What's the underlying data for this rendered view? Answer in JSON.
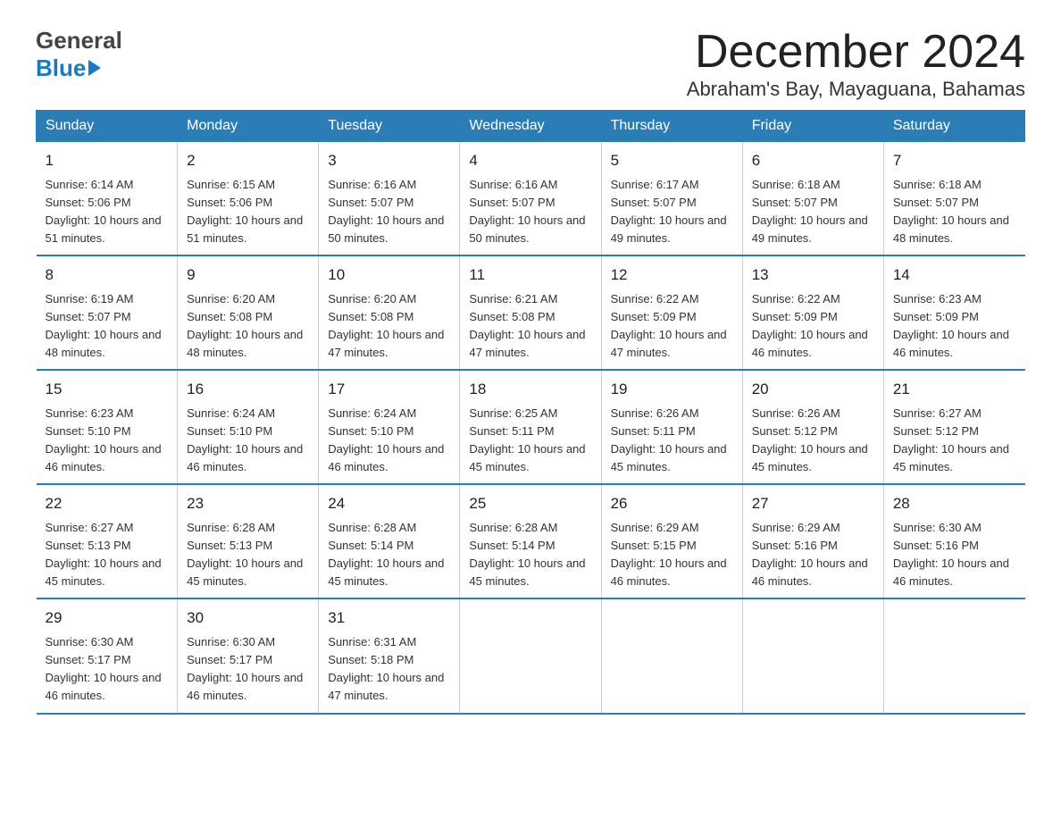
{
  "logo": {
    "top": "General",
    "bottom": "Blue"
  },
  "title": "December 2024",
  "subtitle": "Abraham's Bay, Mayaguana, Bahamas",
  "days_of_week": [
    "Sunday",
    "Monday",
    "Tuesday",
    "Wednesday",
    "Thursday",
    "Friday",
    "Saturday"
  ],
  "weeks": [
    [
      {
        "num": "1",
        "sunrise": "6:14 AM",
        "sunset": "5:06 PM",
        "daylight": "10 hours and 51 minutes."
      },
      {
        "num": "2",
        "sunrise": "6:15 AM",
        "sunset": "5:06 PM",
        "daylight": "10 hours and 51 minutes."
      },
      {
        "num": "3",
        "sunrise": "6:16 AM",
        "sunset": "5:07 PM",
        "daylight": "10 hours and 50 minutes."
      },
      {
        "num": "4",
        "sunrise": "6:16 AM",
        "sunset": "5:07 PM",
        "daylight": "10 hours and 50 minutes."
      },
      {
        "num": "5",
        "sunrise": "6:17 AM",
        "sunset": "5:07 PM",
        "daylight": "10 hours and 49 minutes."
      },
      {
        "num": "6",
        "sunrise": "6:18 AM",
        "sunset": "5:07 PM",
        "daylight": "10 hours and 49 minutes."
      },
      {
        "num": "7",
        "sunrise": "6:18 AM",
        "sunset": "5:07 PM",
        "daylight": "10 hours and 48 minutes."
      }
    ],
    [
      {
        "num": "8",
        "sunrise": "6:19 AM",
        "sunset": "5:07 PM",
        "daylight": "10 hours and 48 minutes."
      },
      {
        "num": "9",
        "sunrise": "6:20 AM",
        "sunset": "5:08 PM",
        "daylight": "10 hours and 48 minutes."
      },
      {
        "num": "10",
        "sunrise": "6:20 AM",
        "sunset": "5:08 PM",
        "daylight": "10 hours and 47 minutes."
      },
      {
        "num": "11",
        "sunrise": "6:21 AM",
        "sunset": "5:08 PM",
        "daylight": "10 hours and 47 minutes."
      },
      {
        "num": "12",
        "sunrise": "6:22 AM",
        "sunset": "5:09 PM",
        "daylight": "10 hours and 47 minutes."
      },
      {
        "num": "13",
        "sunrise": "6:22 AM",
        "sunset": "5:09 PM",
        "daylight": "10 hours and 46 minutes."
      },
      {
        "num": "14",
        "sunrise": "6:23 AM",
        "sunset": "5:09 PM",
        "daylight": "10 hours and 46 minutes."
      }
    ],
    [
      {
        "num": "15",
        "sunrise": "6:23 AM",
        "sunset": "5:10 PM",
        "daylight": "10 hours and 46 minutes."
      },
      {
        "num": "16",
        "sunrise": "6:24 AM",
        "sunset": "5:10 PM",
        "daylight": "10 hours and 46 minutes."
      },
      {
        "num": "17",
        "sunrise": "6:24 AM",
        "sunset": "5:10 PM",
        "daylight": "10 hours and 46 minutes."
      },
      {
        "num": "18",
        "sunrise": "6:25 AM",
        "sunset": "5:11 PM",
        "daylight": "10 hours and 45 minutes."
      },
      {
        "num": "19",
        "sunrise": "6:26 AM",
        "sunset": "5:11 PM",
        "daylight": "10 hours and 45 minutes."
      },
      {
        "num": "20",
        "sunrise": "6:26 AM",
        "sunset": "5:12 PM",
        "daylight": "10 hours and 45 minutes."
      },
      {
        "num": "21",
        "sunrise": "6:27 AM",
        "sunset": "5:12 PM",
        "daylight": "10 hours and 45 minutes."
      }
    ],
    [
      {
        "num": "22",
        "sunrise": "6:27 AM",
        "sunset": "5:13 PM",
        "daylight": "10 hours and 45 minutes."
      },
      {
        "num": "23",
        "sunrise": "6:28 AM",
        "sunset": "5:13 PM",
        "daylight": "10 hours and 45 minutes."
      },
      {
        "num": "24",
        "sunrise": "6:28 AM",
        "sunset": "5:14 PM",
        "daylight": "10 hours and 45 minutes."
      },
      {
        "num": "25",
        "sunrise": "6:28 AM",
        "sunset": "5:14 PM",
        "daylight": "10 hours and 45 minutes."
      },
      {
        "num": "26",
        "sunrise": "6:29 AM",
        "sunset": "5:15 PM",
        "daylight": "10 hours and 46 minutes."
      },
      {
        "num": "27",
        "sunrise": "6:29 AM",
        "sunset": "5:16 PM",
        "daylight": "10 hours and 46 minutes."
      },
      {
        "num": "28",
        "sunrise": "6:30 AM",
        "sunset": "5:16 PM",
        "daylight": "10 hours and 46 minutes."
      }
    ],
    [
      {
        "num": "29",
        "sunrise": "6:30 AM",
        "sunset": "5:17 PM",
        "daylight": "10 hours and 46 minutes."
      },
      {
        "num": "30",
        "sunrise": "6:30 AM",
        "sunset": "5:17 PM",
        "daylight": "10 hours and 46 minutes."
      },
      {
        "num": "31",
        "sunrise": "6:31 AM",
        "sunset": "5:18 PM",
        "daylight": "10 hours and 47 minutes."
      },
      null,
      null,
      null,
      null
    ]
  ]
}
